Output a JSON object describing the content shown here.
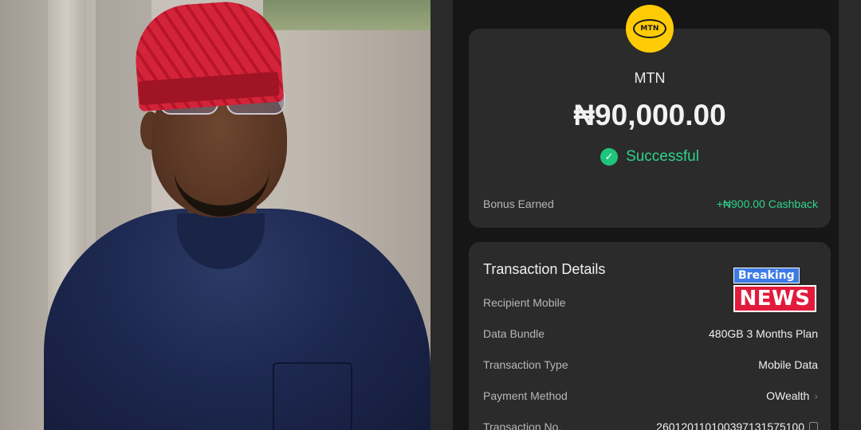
{
  "transaction": {
    "provider": "MTN",
    "logo_text": "MTN",
    "amount": "₦90,000.00",
    "status": "Successful",
    "bonus_label": "Bonus Earned",
    "bonus_value": "+₦900.00 Cashback"
  },
  "details": {
    "title": "Transaction Details",
    "rows": [
      {
        "label": "Recipient Mobile",
        "value": ""
      },
      {
        "label": "Data Bundle",
        "value": "480GB 3 Months Plan"
      },
      {
        "label": "Transaction Type",
        "value": "Mobile Data"
      },
      {
        "label": "Payment Method",
        "value": "OWealth"
      },
      {
        "label": "Transaction No.",
        "value": "260120110100397131575100"
      }
    ]
  },
  "sticker": {
    "top": "Breaking",
    "bottom": "NEWS"
  },
  "colors": {
    "accent_green": "#2ed38a",
    "mtn_yellow": "#ffcb05",
    "card_bg": "#2b2b2b",
    "sticker_red": "#e21b3c",
    "sticker_blue": "#3d7be6"
  }
}
